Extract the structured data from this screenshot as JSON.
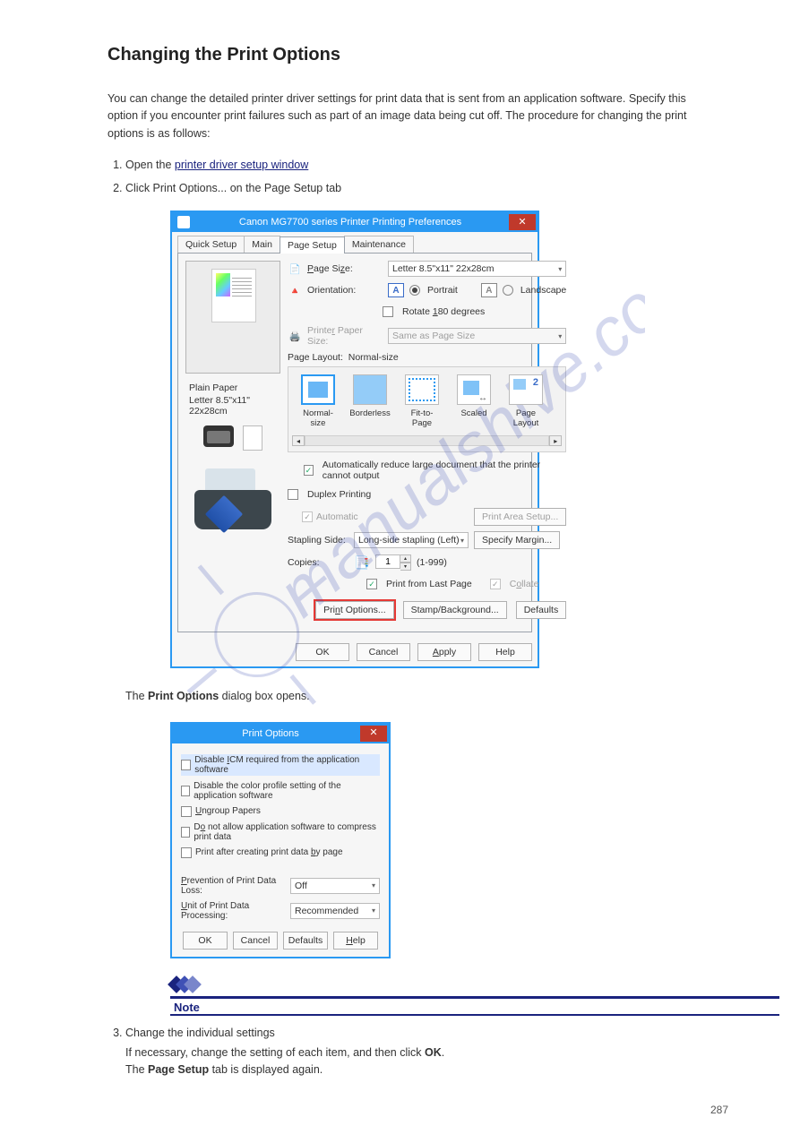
{
  "page": {
    "title": "Changing the Print Options",
    "intro1_pre": "You can change the detailed printer driver settings for print data that is sent from an application software. Specify this option if you encounter print failures such as part of an image data being cut off. The procedure for changing the print options is as follows:",
    "steps": {
      "one": "Open the ",
      "one_link": "printer driver setup window",
      "two_title": "Click Print Options... on the Page Setup tab",
      "two_body": "The Print Options dialog box opens.",
      "three_title": "Change the individual settings",
      "three_body_a": "If necessary, change the setting of each item, and then click ",
      "three_body_b": ".",
      "three_body_c": "The ",
      "three_body_d": " tab is displayed again.",
      "ok_label": "OK",
      "page_setup_label": "Page Setup"
    },
    "note_label": "Note",
    "page_number": "287"
  },
  "dlg1": {
    "title": "Canon MG7700 series Printer Printing Preferences",
    "tabs": [
      "Quick Setup",
      "Main",
      "Page Setup",
      "Maintenance"
    ],
    "preview": {
      "media": "Plain Paper",
      "size": "Letter 8.5\"x11\" 22x28cm"
    },
    "page_size": {
      "label": "Page Size:",
      "value": "Letter 8.5\"x11\" 22x28cm"
    },
    "orientation": {
      "label": "Orientation:",
      "portrait": "Portrait",
      "landscape": "Landscape",
      "rotate": "Rotate 180 degrees"
    },
    "printer_paper_size": {
      "label": "Printer Paper Size:",
      "value": "Same as Page Size"
    },
    "page_layout": {
      "label": "Page Layout:",
      "value": "Normal-size",
      "items": [
        "Normal-size",
        "Borderless",
        "Fit-to-Page",
        "Scaled",
        "Page Layout"
      ]
    },
    "auto_reduce": "Automatically reduce large document that the printer cannot output",
    "duplex": {
      "label": "Duplex Printing",
      "auto": "Automatic",
      "print_area_btn": "Print Area Setup..."
    },
    "stapling": {
      "label": "Stapling Side:",
      "value": "Long-side stapling (Left)",
      "margin_btn": "Specify Margin..."
    },
    "copies": {
      "label": "Copies:",
      "value": "1",
      "range": "(1-999)",
      "from_last": "Print from Last Page",
      "collate": "Collate"
    },
    "buttons": {
      "print_options": "Print Options...",
      "stamp": "Stamp/Background...",
      "defaults": "Defaults"
    },
    "footer": {
      "ok": "OK",
      "cancel": "Cancel",
      "apply": "Apply",
      "help": "Help"
    }
  },
  "dlg2": {
    "title": "Print Options",
    "opts": [
      "Disable ICM required from the application software",
      "Disable the color profile setting of the application software",
      "Ungroup Papers",
      "Do not allow application software to compress print data",
      "Print after creating print data by page"
    ],
    "prev_loss": {
      "label": "Prevention of Print Data Loss:",
      "value": "Off"
    },
    "unit_proc": {
      "label": "Unit of Print Data Processing:",
      "value": "Recommended"
    },
    "footer": {
      "ok": "OK",
      "cancel": "Cancel",
      "defaults": "Defaults",
      "help": "Help"
    }
  }
}
